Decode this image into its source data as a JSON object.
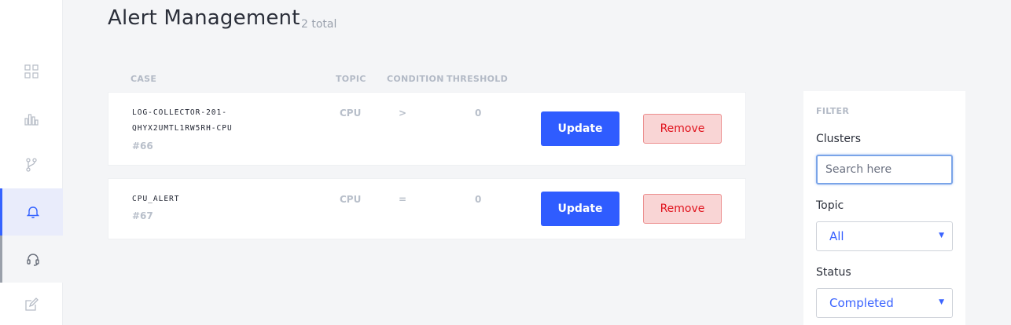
{
  "header": {
    "title": "Alert Management",
    "count": "2 total"
  },
  "sidebar": {
    "items": [
      {
        "icon": "grid-icon",
        "active": false
      },
      {
        "icon": "bar-chart-icon",
        "active": false
      },
      {
        "icon": "branch-icon",
        "active": false
      },
      {
        "icon": "bell-icon",
        "active": true
      },
      {
        "icon": "headset-icon",
        "active": false
      },
      {
        "icon": "edit-icon",
        "active": false
      }
    ]
  },
  "table": {
    "columns": {
      "case": "CASE",
      "topic": "TOPIC",
      "condition": "CONDITION",
      "threshold": "THRESHOLD"
    },
    "rows": [
      {
        "case_line1": "LOG-COLLECTOR-201-",
        "case_line2": "QHYX2UMTL1RW5RH-CPU",
        "id": "#66",
        "topic": "CPU",
        "condition": ">",
        "threshold": "0",
        "update_label": "Update",
        "remove_label": "Remove"
      },
      {
        "case_line1": "CPU_ALERT",
        "id": "#67",
        "topic": "CPU",
        "condition": "=",
        "threshold": "0",
        "update_label": "Update",
        "remove_label": "Remove"
      }
    ]
  },
  "filter": {
    "heading": "FILTER",
    "clusters_label": "Clusters",
    "search_placeholder": "Search here",
    "topic_label": "Topic",
    "topic_value": "All",
    "status_label": "Status",
    "status_value": "Completed"
  },
  "colors": {
    "accent": "#2f5cff",
    "danger_text": "#e0141e",
    "danger_bg": "#f9d5d5"
  }
}
